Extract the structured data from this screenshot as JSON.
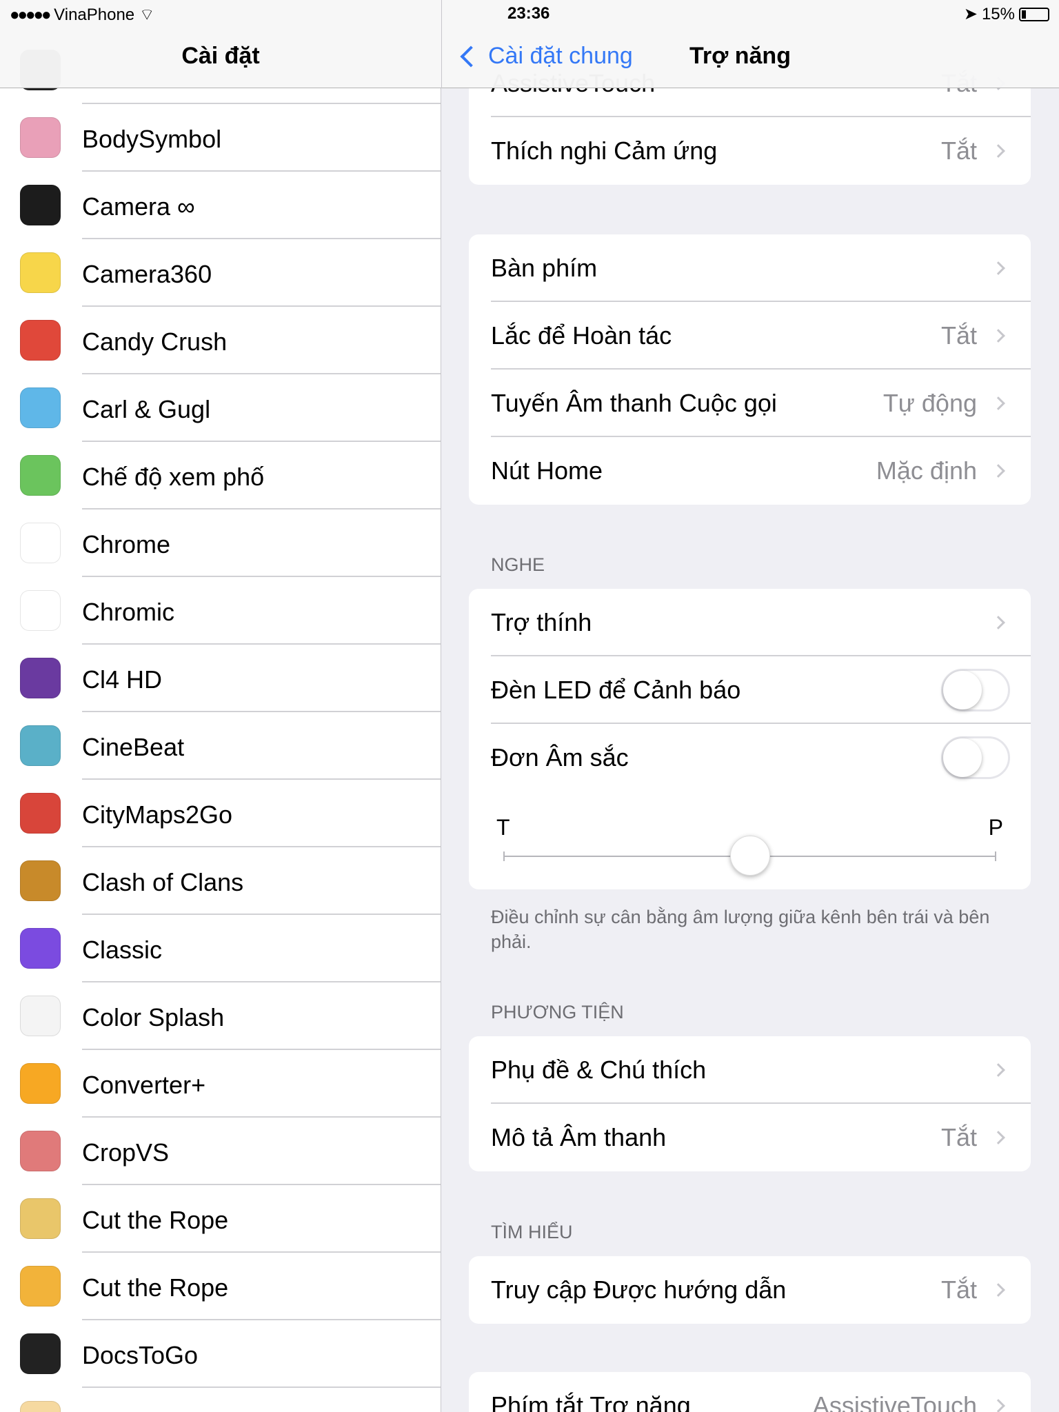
{
  "status": {
    "carrier": "VinaPhone",
    "time": "23:36",
    "battery": "15%"
  },
  "left": {
    "title": "Cài đặt",
    "items": [
      {
        "label": "BodySymbol",
        "color": "#e9a0b8"
      },
      {
        "label": "Camera ∞",
        "color": "#1c1c1c"
      },
      {
        "label": "Camera360",
        "color": "#f7d64a"
      },
      {
        "label": "Candy Crush",
        "color": "#e0483a"
      },
      {
        "label": "Carl & Gugl",
        "color": "#5fb7e8"
      },
      {
        "label": "Chế độ xem phố",
        "color": "#6bc45d"
      },
      {
        "label": "Chrome",
        "color": "#ffffff"
      },
      {
        "label": "Chromic",
        "color": "#ffffff"
      },
      {
        "label": "Cl4 HD",
        "color": "#6a3aa0"
      },
      {
        "label": "CineBeat",
        "color": "#5ab0c8"
      },
      {
        "label": "CityMaps2Go",
        "color": "#d8453a"
      },
      {
        "label": "Clash of Clans",
        "color": "#c88a2a"
      },
      {
        "label": "Classic",
        "color": "#7b4be0"
      },
      {
        "label": "Color Splash",
        "color": "#f4f4f4"
      },
      {
        "label": "Converter+",
        "color": "#f7a823"
      },
      {
        "label": "CropVS",
        "color": "#e07a7a"
      },
      {
        "label": "Cut the Rope",
        "color": "#e9c66a"
      },
      {
        "label": "Cut the Rope",
        "color": "#f2b33a"
      },
      {
        "label": "DocsToGo",
        "color": "#222222"
      },
      {
        "label": "",
        "color": "#f6d9a0"
      }
    ]
  },
  "right": {
    "back": "Cài đặt chung",
    "title": "Trợ năng",
    "group1": [
      {
        "label": "AssistiveTouch",
        "value": "Tắt"
      },
      {
        "label": "Thích nghi Cảm ứng",
        "value": "Tắt"
      }
    ],
    "group2": [
      {
        "label": "Bàn phím",
        "value": ""
      },
      {
        "label": "Lắc để Hoàn tác",
        "value": "Tắt"
      },
      {
        "label": "Tuyến Âm thanh Cuộc gọi",
        "value": "Tự động"
      },
      {
        "label": "Nút Home",
        "value": "Mặc định"
      }
    ],
    "hearing_header": "NGHE",
    "hearing": {
      "hearing_aids": "Trợ thính",
      "led": "Đèn LED để Cảnh báo",
      "led_on": false,
      "mono": "Đơn Âm sắc",
      "mono_on": false,
      "left_label": "T",
      "right_label": "P",
      "balance": 0.5
    },
    "hearing_footer": "Điều chỉnh sự cân bằng âm lượng giữa kênh bên trái và bên phải.",
    "media_header": "PHƯƠNG TIỆN",
    "media": [
      {
        "label": "Phụ đề & Chú thích",
        "value": ""
      },
      {
        "label": "Mô tả Âm thanh",
        "value": "Tắt"
      }
    ],
    "learn_header": "TÌM HIỂU",
    "learn": [
      {
        "label": "Truy cập Được hướng dẫn",
        "value": "Tắt"
      }
    ],
    "shortcut": [
      {
        "label": "Phím tắt Trợ năng",
        "value": "AssistiveTouch"
      }
    ]
  },
  "accent": "#3478f6"
}
